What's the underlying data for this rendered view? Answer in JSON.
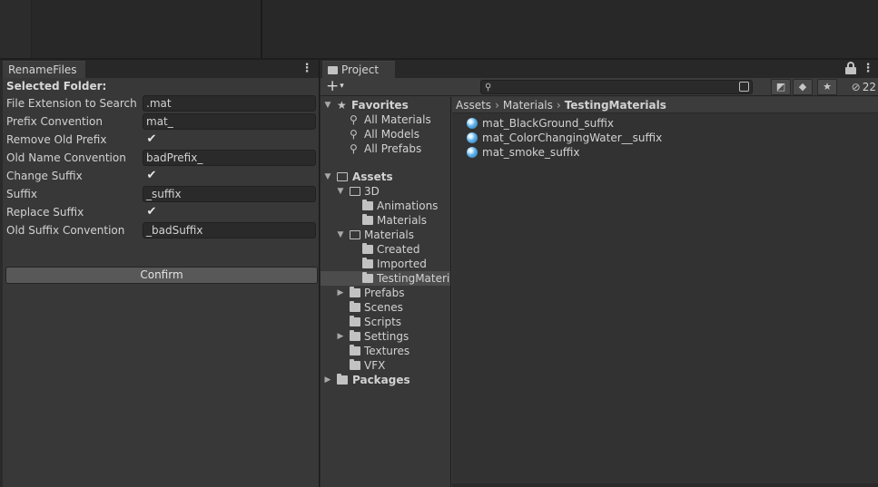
{
  "rename_panel": {
    "tab_label": "RenameFiles",
    "menu_glyph": "⋮",
    "header": "Selected Folder:",
    "fields": [
      {
        "label": "File Extension to Search",
        "type": "text",
        "value": ".mat"
      },
      {
        "label": "Prefix Convention",
        "type": "text",
        "value": "mat_"
      },
      {
        "label": "Remove Old Prefix",
        "type": "check",
        "value": "✔"
      },
      {
        "label": "Old Name Convention",
        "type": "text",
        "value": "badPrefix_"
      },
      {
        "label": "Change Suffix",
        "type": "check",
        "value": "✔"
      },
      {
        "label": "Suffix",
        "type": "text",
        "value": "_suffix"
      },
      {
        "label": "Replace Suffix",
        "type": "check",
        "value": "✔"
      },
      {
        "label": "Old Suffix Convention",
        "type": "text",
        "value": "_badSuffix"
      }
    ],
    "confirm_label": "Confirm"
  },
  "project_panel": {
    "tab_label": "Project",
    "menu_glyph": "⋮",
    "plus_glyph": "+",
    "caret_glyph": "▾",
    "search": {
      "placeholder": ""
    },
    "hidden_count": "22",
    "tree": {
      "favorites_label": "Favorites",
      "favorites": [
        "All Materials",
        "All Models",
        "All Prefabs"
      ],
      "assets_label": "Assets",
      "folders": {
        "f3d": "3D",
        "animations": "Animations",
        "materials3d": "Materials",
        "materials": "Materials",
        "created": "Created",
        "imported": "Imported",
        "testing": "TestingMaterials",
        "prefabs": "Prefabs",
        "scenes": "Scenes",
        "scripts": "Scripts",
        "settings": "Settings",
        "textures": "Textures",
        "vfx": "VFX"
      },
      "packages_label": "Packages"
    },
    "breadcrumb": [
      "Assets",
      "Materials",
      "TestingMaterials"
    ],
    "breadcrumb_sep": "›",
    "files": [
      "mat_BlackGround_suffix",
      "mat_ColorChangingWater__suffix",
      "mat_smoke_suffix"
    ]
  }
}
